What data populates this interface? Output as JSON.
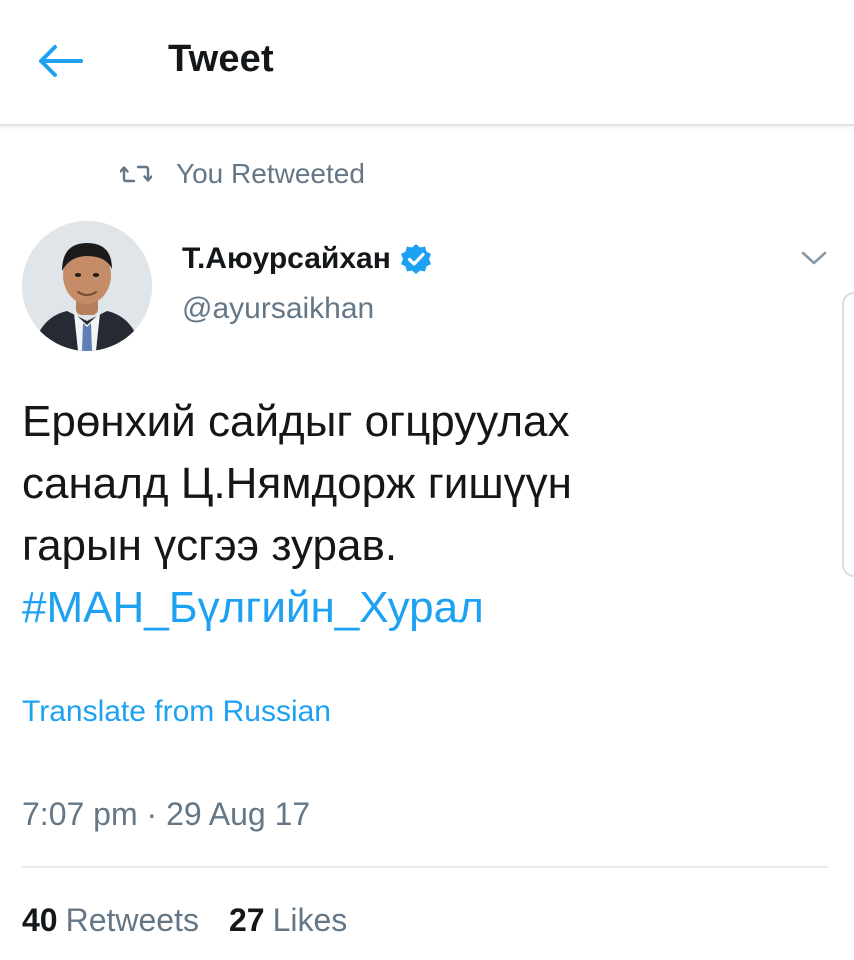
{
  "header": {
    "title": "Tweet",
    "back_icon": "arrow-left-icon"
  },
  "social_context": {
    "icon": "retweet-icon",
    "text": "You Retweeted"
  },
  "author": {
    "name": "Т.Аюурсайхан",
    "handle": "@ayursaikhan",
    "verified_icon": "verified-badge-icon",
    "menu_icon": "chevron-down-icon"
  },
  "tweet": {
    "lines": [
      "Ерөнхий сайдыг огцруулах",
      "саналд Ц.Нямдорж гишүүн",
      "гарын үсгээ зурав."
    ],
    "hashtag": "#МАН_Бүлгийн_Хурал",
    "translate_label": "Translate from Russian",
    "timestamp": "7:07 pm · 29 Aug 17"
  },
  "stats": {
    "retweets_count": "40",
    "retweets_label": "Retweets",
    "likes_count": "27",
    "likes_label": "Likes"
  },
  "colors": {
    "accent": "#1da1f2",
    "secondary_text": "#657786",
    "primary_text": "#14171a"
  }
}
